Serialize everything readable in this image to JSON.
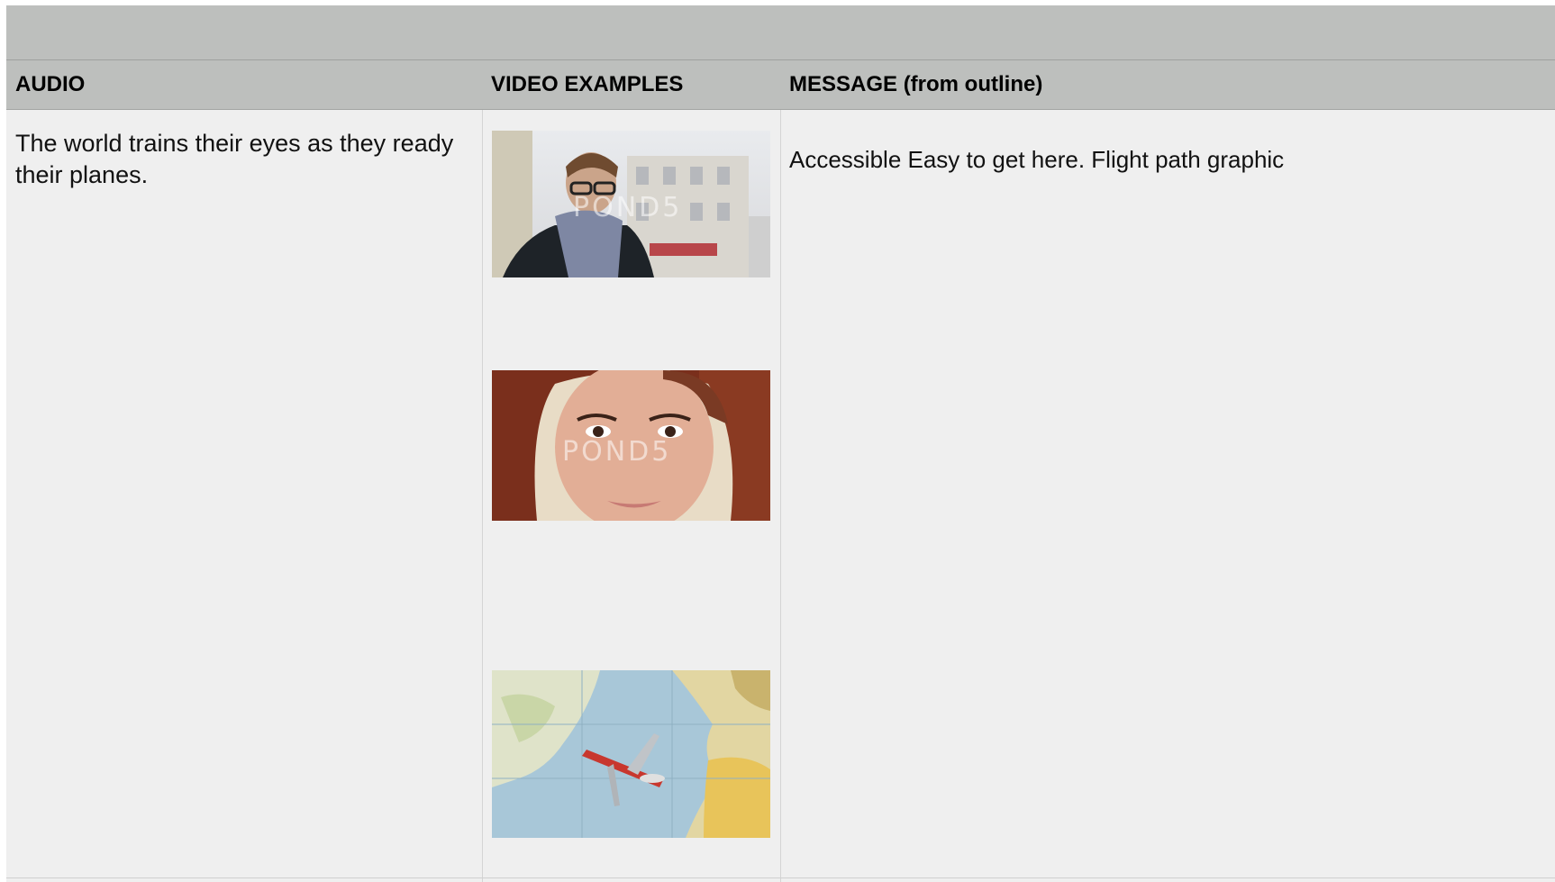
{
  "table": {
    "headers": {
      "audio": "AUDIO",
      "video": "VIDEO EXAMPLES",
      "message": "MESSAGE (from outline)"
    },
    "rows": [
      {
        "audio": "The world trains their eyes as they ready their planes.",
        "message": "Accessible Easy to get here. Flight path graphic",
        "video_examples": [
          {
            "icon": "man-in-scarf-thumbnail",
            "watermark": "POND5"
          },
          {
            "icon": "woman-headscarf-thumbnail",
            "watermark": "POND5"
          },
          {
            "icon": "airplane-on-map-thumbnail"
          }
        ]
      }
    ]
  }
}
